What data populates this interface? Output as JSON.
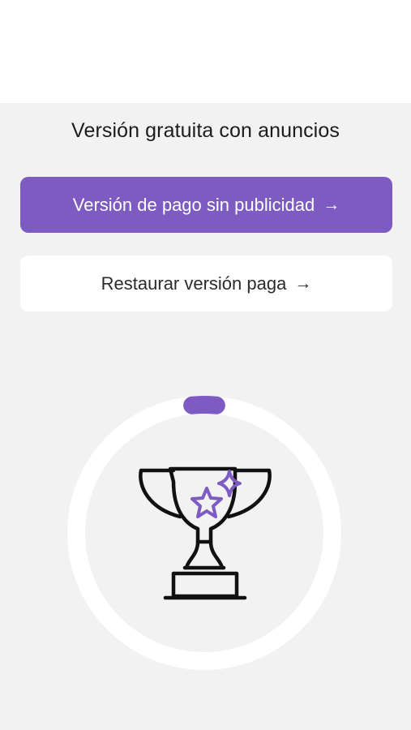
{
  "status": {
    "title": "Versión gratuita con anuncios"
  },
  "buttons": {
    "paid_label": "Versión de pago sin publicidad",
    "restore_label": "Restaurar versión paga",
    "arrow_icon": "arrow-right-icon"
  },
  "progress": {
    "fraction": 0.03
  },
  "colors": {
    "accent": "#7d5bc1",
    "background": "#f2f2f2",
    "card": "#ffffff",
    "text": "#1c1c1e"
  }
}
